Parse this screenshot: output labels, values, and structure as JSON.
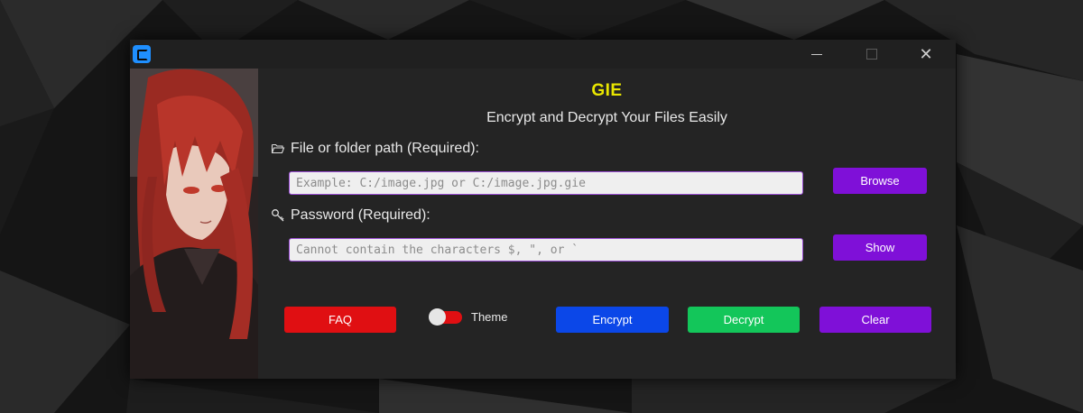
{
  "window": {
    "controls": {
      "minimize_icon": "minimize-icon",
      "maximize_icon": "maximize-icon",
      "close_icon": "close-icon"
    }
  },
  "app": {
    "title": "GIE",
    "subtitle": "Encrypt and Decrypt Your Files Easily"
  },
  "path_field": {
    "label": "File or folder path (Required):",
    "icon": "folder-open-icon",
    "value": "",
    "placeholder": "Example: C:/image.jpg or C:/image.jpg.gie",
    "browse_label": "Browse"
  },
  "password_field": {
    "label": "Password (Required):",
    "icon": "key-icon",
    "value": "",
    "placeholder": "Cannot contain the characters $, \", or `",
    "show_label": "Show"
  },
  "actions": {
    "faq_label": "FAQ",
    "theme_label": "Theme",
    "encrypt_label": "Encrypt",
    "decrypt_label": "Decrypt",
    "clear_label": "Clear"
  },
  "colors": {
    "title_yellow": "#e9e600",
    "purple": "#7f10d8",
    "red": "#e00f12",
    "blue": "#0b47e8",
    "green": "#13c65a",
    "window_bg": "#242424"
  }
}
